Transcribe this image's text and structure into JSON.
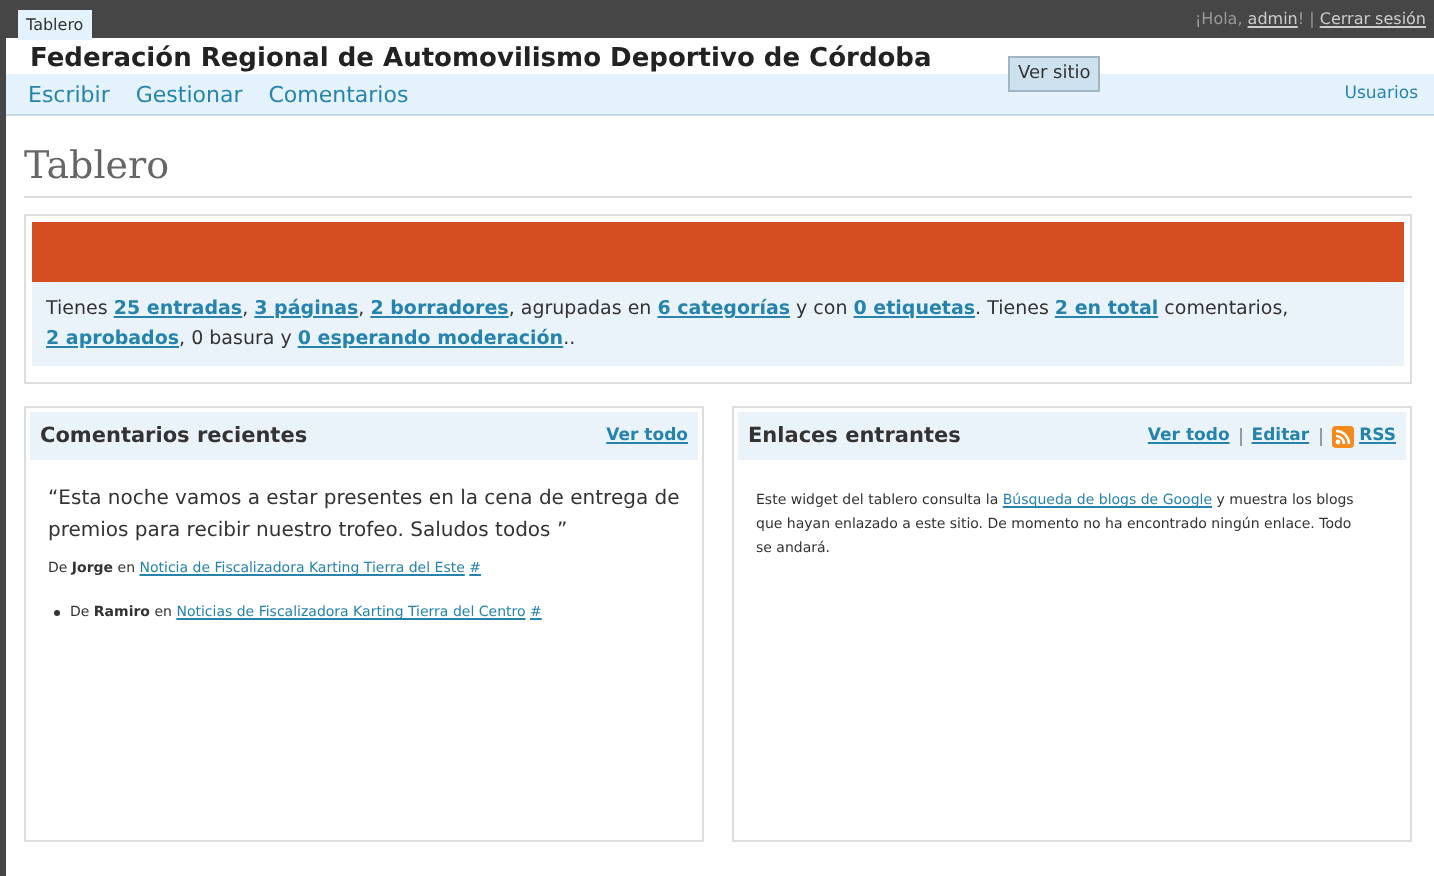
{
  "top_tabs": [
    {
      "label": "Tablero",
      "selected": true
    }
  ],
  "user_bar": [
    {
      "text": "¡Hola, ",
      "kind": "text"
    },
    {
      "text": "admin",
      "kind": "link"
    },
    {
      "text": "! | ",
      "kind": "text"
    },
    {
      "text": "Cerrar sesión",
      "kind": "link"
    }
  ],
  "site_title": "Federación Regional de Automovilismo Deportivo de Córdoba",
  "view_site_button": "Ver sitio",
  "nav": [
    {
      "label": "Escribir"
    },
    {
      "label": "Gestionar"
    },
    {
      "label": "Comentarios"
    }
  ],
  "nav_right": "Usuarios",
  "page_title": "Tablero",
  "banner": {
    "color": "#d54e21"
  },
  "stats": [
    {
      "text": "Tienes ",
      "kind": "text"
    },
    {
      "text": "25 entradas",
      "kind": "link"
    },
    {
      "text": ", ",
      "kind": "text"
    },
    {
      "text": "3 páginas",
      "kind": "link"
    },
    {
      "text": ", ",
      "kind": "text"
    },
    {
      "text": "2 borradores",
      "kind": "link"
    },
    {
      "text": ", agrupadas en ",
      "kind": "text"
    },
    {
      "text": "6 categorías",
      "kind": "link"
    },
    {
      "text": " y con ",
      "kind": "text"
    },
    {
      "text": "0 etiquetas",
      "kind": "link"
    },
    {
      "text": ". Tienes ",
      "kind": "text"
    },
    {
      "text": "2 en total",
      "kind": "link"
    },
    {
      "text": " comentarios, ",
      "kind": "text"
    },
    {
      "text": "2 aprobados",
      "kind": "link"
    },
    {
      "text": ", 0 basura y ",
      "kind": "text"
    },
    {
      "text": "0 esperando moderación",
      "kind": "link"
    },
    {
      "text": "..",
      "kind": "text"
    }
  ],
  "recent_comments": {
    "title": "Comentarios recientes",
    "link": "Ver todo",
    "quote": "“Esta noche vamos a estar presentes en la cena de entrega de premios para recibir nuestro trofeo. Saludos todos ”",
    "items": [
      {
        "bullet": false,
        "prefix": "De ",
        "author": "Jorge",
        "mid": " en ",
        "post": "Noticia de Fiscalizadora Karting Tierra del Este",
        "hash": "#"
      },
      {
        "bullet": true,
        "prefix": "De ",
        "author": "Ramiro",
        "mid": " en ",
        "post": "Noticias de Fiscalizadora Karting Tierra del Centro",
        "hash": "#"
      }
    ]
  },
  "incoming_links": {
    "title": "Enlaces entrantes",
    "links": [
      "Ver todo",
      "Editar"
    ],
    "rss": "RSS",
    "text": [
      {
        "text": "Este widget del tablero consulta la ",
        "kind": "text"
      },
      {
        "text": "Búsqueda de blogs de Google",
        "kind": "link"
      },
      {
        "text": " y muestra los blogs que hayan enlazado a este sitio. De momento no ha encontrado ningún enlace. Todo se andará.",
        "kind": "text"
      }
    ]
  }
}
